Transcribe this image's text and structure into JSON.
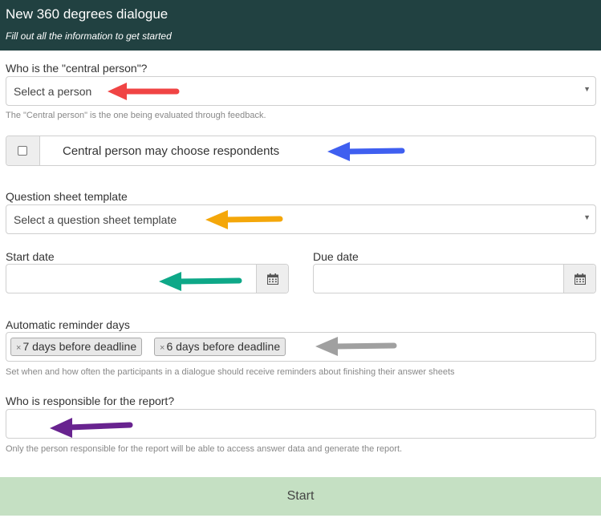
{
  "header": {
    "title": "New 360 degrees dialogue",
    "subtitle": "Fill out all the information to get started"
  },
  "central_person": {
    "label": "Who is the \"central person\"?",
    "placeholder": "Select a person",
    "help": "The \"Central person\" is the one being evaluated through feedback."
  },
  "respondents_option": {
    "label": "Central person may choose respondents",
    "checked": false
  },
  "template": {
    "label": "Question sheet template",
    "placeholder": "Select a question sheet template"
  },
  "start_date": {
    "label": "Start date",
    "value": ""
  },
  "due_date": {
    "label": "Due date",
    "value": ""
  },
  "reminders": {
    "label": "Automatic reminder days",
    "tags": [
      {
        "label": "7 days before deadline"
      },
      {
        "label": "6 days before deadline"
      }
    ],
    "remove_glyph": "×",
    "help": "Set when and how often the participants in a dialogue should receive reminders about finishing their answer sheets"
  },
  "responsible": {
    "label": "Who is responsible for the report?",
    "value": "",
    "help": "Only the person responsible for the report will be able to access answer data and generate the report."
  },
  "submit": {
    "label": "Start"
  },
  "annotations": {
    "arrow_colors": {
      "central_person": "#f04444",
      "respondents": "#3f5ff0",
      "template": "#f4a70a",
      "start_date": "#0ea888",
      "reminders": "#a0a0a0",
      "responsible": "#68238f"
    }
  },
  "colors": {
    "header_bg": "#214141",
    "submit_bg": "#c5e0c3"
  }
}
